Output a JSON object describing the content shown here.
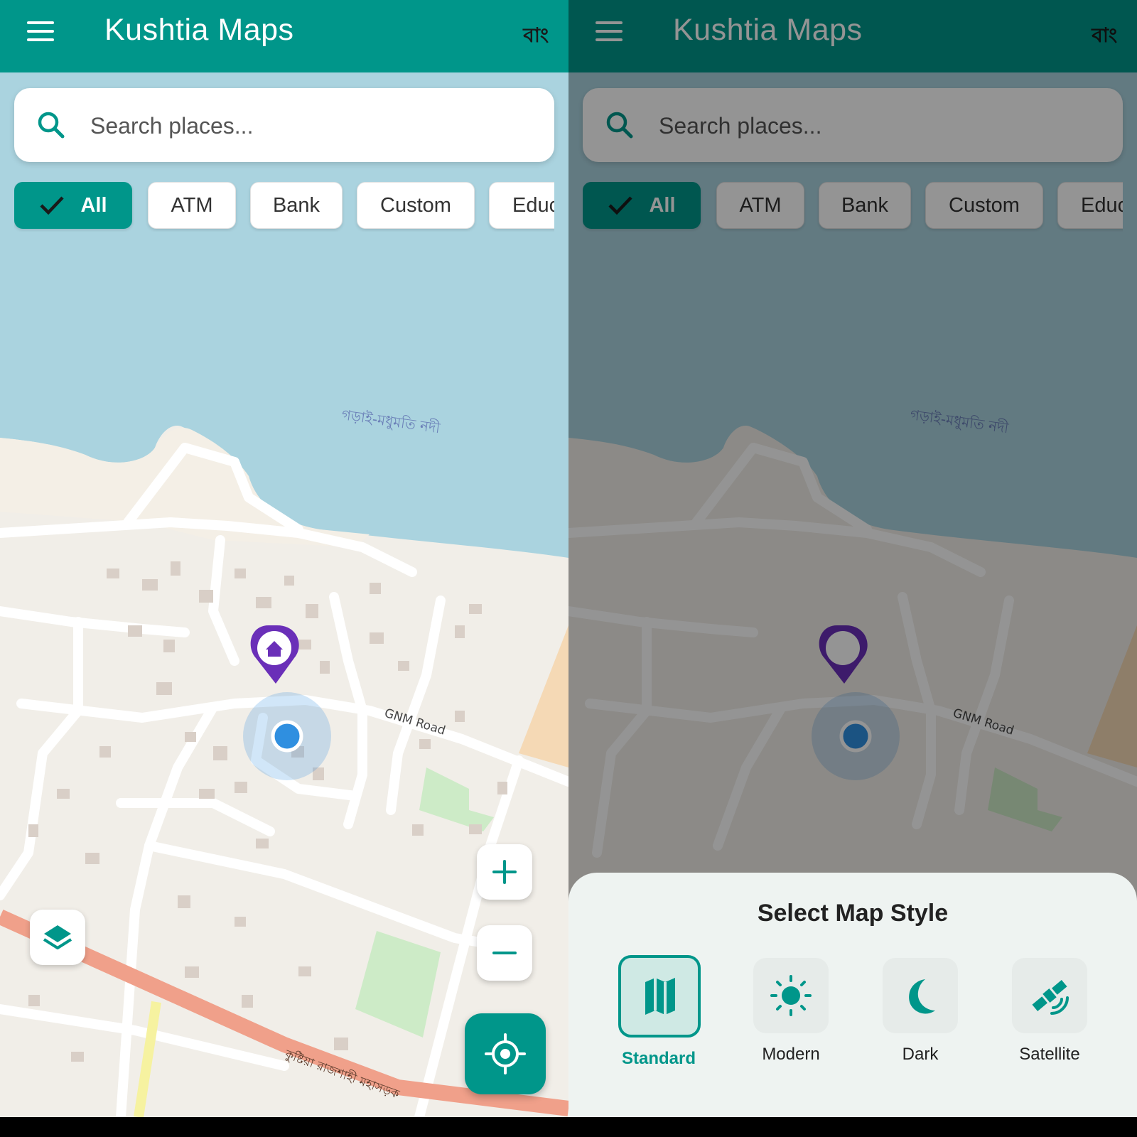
{
  "app": {
    "title": "Kushtia Maps",
    "lang_toggle": "বাং"
  },
  "search": {
    "placeholder": "Search places..."
  },
  "categories": [
    {
      "label": "All",
      "active": true
    },
    {
      "label": "ATM",
      "active": false
    },
    {
      "label": "Bank",
      "active": false
    },
    {
      "label": "Custom",
      "active": false
    },
    {
      "label": "Educ",
      "active": false
    }
  ],
  "map": {
    "river_label": "গড়াই-মধুমতি নদী",
    "road_label": "GNM Road",
    "highway_label": "কুষ্টিয়া রাজশাহী মহাসড়ক"
  },
  "map_style_sheet": {
    "title": "Select Map Style",
    "options": [
      {
        "label": "Standard",
        "icon": "map-icon",
        "selected": true
      },
      {
        "label": "Modern",
        "icon": "sun-icon",
        "selected": false
      },
      {
        "label": "Dark",
        "icon": "moon-icon",
        "selected": false
      },
      {
        "label": "Satellite",
        "icon": "satellite-icon",
        "selected": false
      }
    ]
  },
  "colors": {
    "primary": "#00968a",
    "water": "#aad3df",
    "land": "#f1eee8",
    "highway": "#f0a08a",
    "park": "#cdebc7",
    "location_dot": "#2f8fe0",
    "marker": "#6a2fb8"
  }
}
